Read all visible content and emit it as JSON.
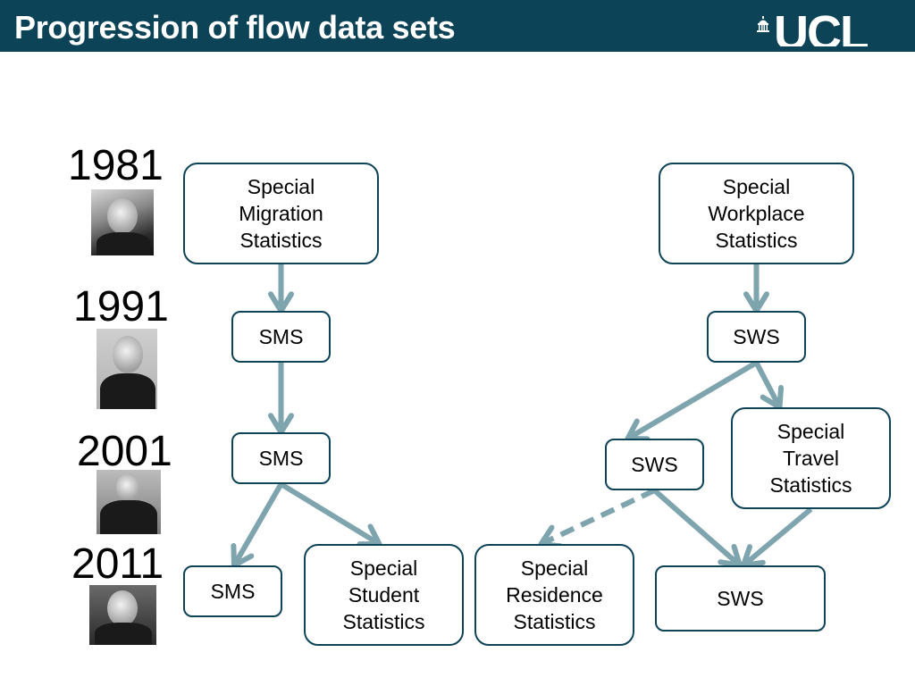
{
  "header": {
    "title": "Progression of flow data sets",
    "logo_text": "UCL",
    "logo_icon": "portico-dome-icon"
  },
  "colors": {
    "header_bg": "#0d4357",
    "node_border": "#0d4357",
    "arrow": "#7ea4ad"
  },
  "timeline": [
    {
      "year": "1981",
      "photo": "portrait-1981"
    },
    {
      "year": "1991",
      "photo": "portrait-1991"
    },
    {
      "year": "2001",
      "photo": "portrait-2001"
    },
    {
      "year": "2011",
      "photo": "portrait-2011"
    }
  ],
  "nodes": {
    "sms_1981": "Special\nMigration\nStatistics",
    "sms_1991": "SMS",
    "sms_2001": "SMS",
    "sms_2011": "SMS",
    "sss_2011": "Special\nStudent\nStatistics",
    "sws_1981": "Special\nWorkplace\nStatistics",
    "sws_1991": "SWS",
    "sws_2001": "SWS",
    "sts_2001": "Special\nTravel\nStatistics",
    "srs_2011": "Special\nResidence\nStatistics",
    "sws_2011": "SWS"
  },
  "edges": [
    {
      "from": "sms_1981",
      "to": "sms_1991",
      "style": "solid"
    },
    {
      "from": "sms_1991",
      "to": "sms_2001",
      "style": "solid"
    },
    {
      "from": "sms_2001",
      "to": "sms_2011",
      "style": "solid"
    },
    {
      "from": "sms_2001",
      "to": "sss_2011",
      "style": "solid"
    },
    {
      "from": "sws_1981",
      "to": "sws_1991",
      "style": "solid"
    },
    {
      "from": "sws_1991",
      "to": "sws_2001",
      "style": "solid"
    },
    {
      "from": "sws_1991",
      "to": "sts_2001",
      "style": "solid"
    },
    {
      "from": "sws_2001",
      "to": "srs_2011",
      "style": "dashed"
    },
    {
      "from": "sws_2001",
      "to": "sws_2011",
      "style": "solid"
    },
    {
      "from": "sts_2001",
      "to": "sws_2011",
      "style": "solid"
    }
  ]
}
